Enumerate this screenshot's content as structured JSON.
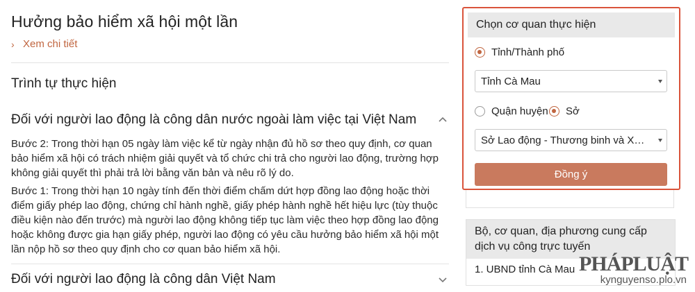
{
  "page": {
    "title": "Hưởng bảo hiểm xã hội một lần",
    "detail_link": "Xem chi tiết",
    "section_title": "Trình tự thực hiện"
  },
  "accordion": [
    {
      "heading": "Đối với người lao động là công dân nước ngoài làm việc tại Việt Nam",
      "expanded": true,
      "paragraphs": [
        "Bước 2: Trong thời hạn 05 ngày làm việc kể từ ngày nhận đủ hồ sơ theo quy định, cơ quan bảo hiểm xã hội có trách nhiệm giải quyết và tổ chức chi trả cho người lao động, trường hợp không giải quyết thì phải trả lời bằng văn bản và nêu rõ lý do.",
        "Bước 1: Trong thời hạn 10 ngày tính đến thời điểm chấm dứt hợp đồng lao động hoặc thời điểm giấy phép lao động, chứng chỉ hành nghề, giấy phép hành nghề hết hiệu lực (tùy thuộc điều kiện nào đến trước) mà người lao động không tiếp tục làm việc theo hợp đồng lao động hoặc không được gia hạn giấy phép, người lao động có yêu cầu hưởng bảo hiểm xã hội một lần nộp hồ sơ theo quy định cho cơ quan bảo hiểm xã hội."
      ]
    },
    {
      "heading": "Đối với người lao động là công dân Việt Nam",
      "expanded": false
    }
  ],
  "agency_panel": {
    "header": "Chọn cơ quan thực hiện",
    "radio_province": "Tỉnh/Thành phố",
    "province_select": "Tỉnh Cà Mau",
    "radio_district": "Quận huyện",
    "radio_department": "Sở",
    "department_select": "Sở Lao động - Thương binh và Xã hội tỉnh Cà Mau",
    "submit": "Đồng ý",
    "accent_color": "#d9533a",
    "button_color": "#c97a5e"
  },
  "online_services": {
    "header": "Bộ, cơ quan, địa phương cung cấp dịch vụ công trực tuyến",
    "items": [
      "1. UBND tỉnh Cà Mau"
    ]
  },
  "watermark": {
    "logo": "PHÁPLUẬT",
    "url": "kynguyenso.plo.vn"
  }
}
